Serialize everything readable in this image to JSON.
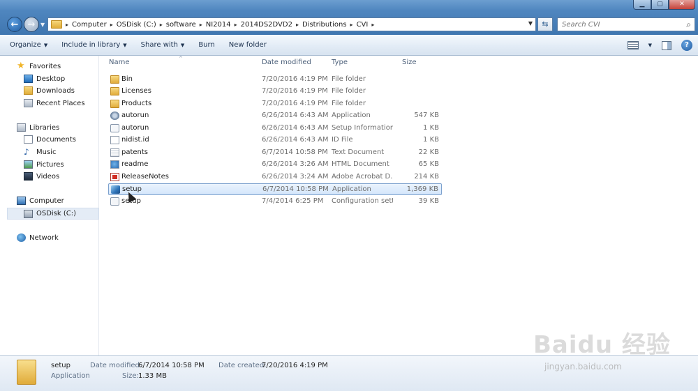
{
  "window": {
    "controls": {
      "minimize": "▁",
      "maximize": "▢",
      "close": "✕"
    }
  },
  "address": {
    "crumbs": [
      "Computer",
      "OSDisk (C:)",
      "software",
      "NI2014",
      "2014DS2DVD2",
      "Distributions",
      "CVI"
    ],
    "separator": "▸"
  },
  "search": {
    "placeholder": "Search CVI"
  },
  "toolbar": {
    "organize": "Organize",
    "include_in_library": "Include in library",
    "share_with": "Share with",
    "burn": "Burn",
    "new_folder": "New folder"
  },
  "sidebar": {
    "favorites": "Favorites",
    "desktop": "Desktop",
    "downloads": "Downloads",
    "recent_places": "Recent Places",
    "libraries": "Libraries",
    "documents": "Documents",
    "music": "Music",
    "pictures": "Pictures",
    "videos": "Videos",
    "computer": "Computer",
    "osdisk": "OSDisk (C:)",
    "network": "Network"
  },
  "columns": {
    "name": "Name",
    "date": "Date modified",
    "type": "Type",
    "size": "Size"
  },
  "files": [
    {
      "name": "Bin",
      "date": "7/20/2016 4:19 PM",
      "type": "File folder",
      "size": "",
      "icon": "folder-icon"
    },
    {
      "name": "Licenses",
      "date": "7/20/2016 4:19 PM",
      "type": "File folder",
      "size": "",
      "icon": "folder-icon"
    },
    {
      "name": "Products",
      "date": "7/20/2016 4:19 PM",
      "type": "File folder",
      "size": "",
      "icon": "folder-icon"
    },
    {
      "name": "autorun",
      "date": "6/26/2014 6:43 AM",
      "type": "Application",
      "size": "547 KB",
      "icon": "application-icon"
    },
    {
      "name": "autorun",
      "date": "6/26/2014 6:43 AM",
      "type": "Setup Information",
      "size": "1 KB",
      "icon": "setup-information-icon"
    },
    {
      "name": "nidist.id",
      "date": "6/26/2014 6:43 AM",
      "type": "ID File",
      "size": "1 KB",
      "icon": "blank-file-icon"
    },
    {
      "name": "patents",
      "date": "6/7/2014 10:58 PM",
      "type": "Text Document",
      "size": "22 KB",
      "icon": "text-document-icon"
    },
    {
      "name": "readme",
      "date": "6/26/2014 3:26 AM",
      "type": "HTML Document",
      "size": "65 KB",
      "icon": "html-document-icon"
    },
    {
      "name": "ReleaseNotes",
      "date": "6/26/2014 3:24 AM",
      "type": "Adobe Acrobat D...",
      "size": "214 KB",
      "icon": "pdf-icon"
    },
    {
      "name": "setup",
      "date": "6/7/2014 10:58 PM",
      "type": "Application",
      "size": "1,369 KB",
      "icon": "setup-application-icon",
      "selected": true
    },
    {
      "name": "setup",
      "date": "7/4/2014 6:25 PM",
      "type": "Configuration sett...",
      "size": "39 KB",
      "icon": "configuration-icon"
    }
  ],
  "details": {
    "name": "setup",
    "type": "Application",
    "date_modified_label": "Date modified:",
    "date_modified": "6/7/2014 10:58 PM",
    "date_created_label": "Date created:",
    "date_created": "7/20/2016 4:19 PM",
    "size_label": "Size:",
    "size": "1.33 MB"
  },
  "watermark": {
    "brand": "Baidu 经验",
    "url": "jingyan.baidu.com"
  }
}
